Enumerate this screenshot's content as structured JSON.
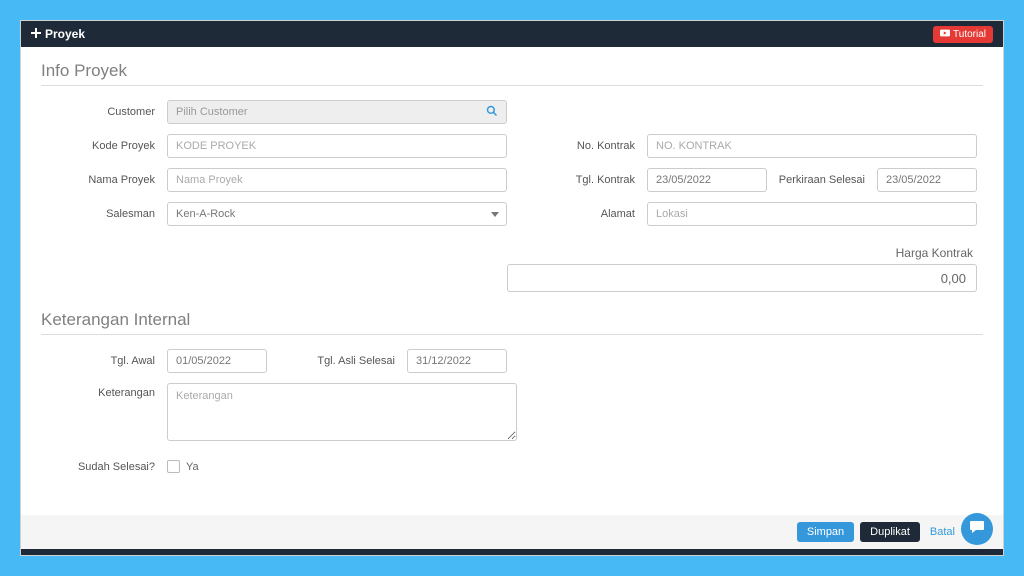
{
  "header": {
    "title": "Proyek",
    "tutorial_label": "Tutorial"
  },
  "info_proyek": {
    "section_title": "Info Proyek",
    "customer_label": "Customer",
    "customer_placeholder": "Pilih Customer",
    "kode_label": "Kode Proyek",
    "kode_placeholder": "KODE PROYEK",
    "nama_label": "Nama Proyek",
    "nama_placeholder": "Nama Proyek",
    "salesman_label": "Salesman",
    "salesman_value": "Ken-A-Rock",
    "no_kontrak_label": "No. Kontrak",
    "no_kontrak_placeholder": "NO. KONTRAK",
    "tgl_kontrak_label": "Tgl. Kontrak",
    "tgl_kontrak_value": "23/05/2022",
    "perkiraan_label": "Perkiraan Selesai",
    "perkiraan_value": "23/05/2022",
    "alamat_label": "Alamat",
    "alamat_placeholder": "Lokasi",
    "harga_label": "Harga Kontrak",
    "harga_value": "0,00"
  },
  "keterangan_internal": {
    "section_title": "Keterangan Internal",
    "tgl_awal_label": "Tgl. Awal",
    "tgl_awal_value": "01/05/2022",
    "tgl_asli_label": "Tgl. Asli Selesai",
    "tgl_asli_value": "31/12/2022",
    "keterangan_label": "Keterangan",
    "keterangan_placeholder": "Keterangan",
    "sudah_label": "Sudah Selesai?",
    "ya_label": "Ya"
  },
  "footer": {
    "simpan": "Simpan",
    "duplikat": "Duplikat",
    "batal": "Batal"
  }
}
